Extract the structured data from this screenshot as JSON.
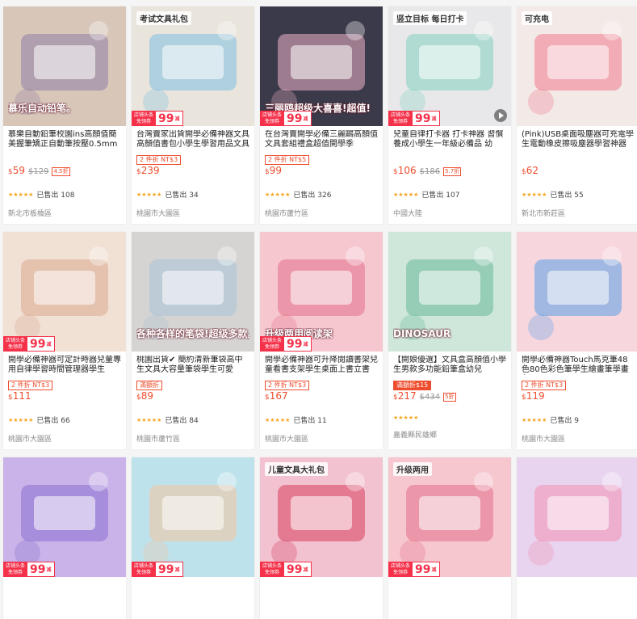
{
  "coupon": {
    "tag_line1": "店铺头条",
    "tag_line2": "免领券",
    "amount": "99",
    "unit": "减"
  },
  "products": [
    {
      "title": "慕樂自動鉛筆校園ins高顏值簡美握筆矯正自動筆按壓0.5mm",
      "thumb_headline": "慕乐自动铅笔。",
      "thumb_subhead": "",
      "promo": "",
      "promo_style": "",
      "price": "59",
      "orig": "$129",
      "disc": "4.5折",
      "stars": "★★★★★",
      "sold": "已售出 108",
      "location": "新北市板橋區",
      "bg": "#d8c6b9",
      "accent": "#8f7fa6",
      "has_coupon": false,
      "has_play": false
    },
    {
      "title": "台灣賣家出貨開學必備神器文具高顏值書包小學生學習用品文具",
      "thumb_headline": "",
      "thumb_subhead": "考试文具礼包",
      "promo": "2 件折 NT$3",
      "promo_style": "outline",
      "price": "239",
      "orig": "",
      "disc": "",
      "stars": "★★★★★",
      "sold": "已售出 34",
      "location": "桃園市大園區",
      "bg": "#e9e4dc",
      "accent": "#7fbfe0",
      "has_coupon": true,
      "has_play": false
    },
    {
      "title": "在台灣賣開學必備三麗鷗高顏值文具套組禮盒超值開學季",
      "thumb_headline": "三丽鸥超级大喜喜!超值!",
      "thumb_subhead": "",
      "promo": "2 件折 NT$5",
      "promo_style": "outline",
      "price": "99",
      "orig": "",
      "disc": "",
      "stars": "★★★★★",
      "sold": "已售出 326",
      "location": "桃園市蘆竹區",
      "bg": "#3b3a4a",
      "accent": "#f0b3c8",
      "has_coupon": true,
      "has_play": false
    },
    {
      "title": "兒童自律打卡器 打卡神器 習慣養成小學生一年級必備品 幼",
      "thumb_headline": "",
      "thumb_subhead": "竖立目标 每日打卡",
      "promo": "",
      "promo_style": "",
      "price": "106",
      "orig": "$186",
      "disc": "5.7折",
      "stars": "★★★★★",
      "sold": "已售出 107",
      "location": "中國大陸",
      "bg": "#e8e8ea",
      "accent": "#7fd0c0",
      "has_coupon": true,
      "has_play": true
    },
    {
      "title": "(Pink)USB桌面吸塵器可充電學生電動橡皮擦吸塵器學習神器",
      "thumb_headline": "",
      "thumb_subhead": "可充电",
      "promo": "",
      "promo_style": "",
      "price": "62",
      "orig": "",
      "disc": "",
      "stars": "★★★★★",
      "sold": "已售出 55",
      "location": "新北市新莊區",
      "bg": "#f3e9e6",
      "accent": "#ee7a8e",
      "has_coupon": false,
      "has_play": false
    },
    {
      "title": "開學必備神器可定計時器兒童專用自律學習時間管理器學生",
      "thumb_headline": "",
      "thumb_subhead": "",
      "promo": "2 件折 NT$3",
      "promo_style": "outline",
      "price": "111",
      "orig": "",
      "disc": "",
      "stars": "★★★★★",
      "sold": "已售出 66",
      "location": "桃園市大園區",
      "bg": "#f1e0d4",
      "accent": "#d8a98e",
      "has_coupon": true,
      "has_play": false
    },
    {
      "title": "桃園出貨✔ 簡約清新筆袋高中生文具大容量筆袋學生可愛",
      "thumb_headline": "各种各样的笔袋!超级多款。",
      "thumb_subhead": "",
      "promo": "滿額折",
      "promo_style": "outline",
      "price": "89",
      "orig": "",
      "disc": "",
      "stars": "★★★★★",
      "sold": "已售出 84",
      "location": "桃園市蘆竹區",
      "bg": "#d6d4d2",
      "accent": "#a7c2d8",
      "has_coupon": false,
      "has_play": false
    },
    {
      "title": "開學必備神器可升降閱讀書架兒童看書支架學生桌面上書立書",
      "thumb_headline": "升级两用阅读架",
      "thumb_subhead": "",
      "promo": "2 件折 NT$3",
      "promo_style": "outline",
      "price": "167",
      "orig": "",
      "disc": "",
      "stars": "★★★★★",
      "sold": "已售出 11",
      "location": "桃園市大園區",
      "bg": "#f6c7cf",
      "accent": "#e46f8b",
      "has_coupon": true,
      "has_play": false
    },
    {
      "title": "【開娘優選】文具盒高顏值小學生男款多功能鉛筆盒幼兒",
      "thumb_headline": "DINOSAUR",
      "thumb_subhead": "",
      "promo": "滿額折$15",
      "promo_style": "solid",
      "price": "217",
      "orig": "$434",
      "disc": "5折",
      "stars": "★★★★★",
      "sold": "",
      "location": "嘉義縣民雄鄉",
      "bg": "#cfe7da",
      "accent": "#67b89a",
      "has_coupon": false,
      "has_play": false
    },
    {
      "title": "開學必備神器Touch馬克筆48色80色彩色筆學生繪畫筆學畫必",
      "thumb_headline": "",
      "thumb_subhead": "",
      "promo": "2 件折 NT$3",
      "promo_style": "outline",
      "price": "119",
      "orig": "",
      "disc": "",
      "stars": "★★★★★",
      "sold": "已售出 9",
      "location": "桃園市大園區",
      "bg": "#f7d6de",
      "accent": "#5aa0e6",
      "has_coupon": false,
      "has_play": false
    },
    {
      "title": "",
      "thumb_headline": "",
      "thumb_subhead": "",
      "promo": "",
      "promo_style": "",
      "price": "",
      "orig": "",
      "disc": "",
      "stars": "",
      "sold": "",
      "location": "",
      "bg": "#c9b3e8",
      "accent": "#8a6fd2",
      "has_coupon": true,
      "has_play": false
    },
    {
      "title": "",
      "thumb_headline": "",
      "thumb_subhead": "",
      "promo": "",
      "promo_style": "",
      "price": "",
      "orig": "",
      "disc": "",
      "stars": "",
      "sold": "",
      "location": "",
      "bg": "#bde2ec",
      "accent": "#f5c4a0",
      "has_coupon": true,
      "has_play": false
    },
    {
      "title": "",
      "thumb_headline": "",
      "thumb_subhead": "儿童文具大礼包",
      "promo": "",
      "promo_style": "",
      "price": "",
      "orig": "",
      "disc": "",
      "stars": "",
      "sold": "",
      "location": "",
      "bg": "#f3c2d0",
      "accent": "#d7405f",
      "has_coupon": true,
      "has_play": false
    },
    {
      "title": "",
      "thumb_headline": "",
      "thumb_subhead": "升级两用",
      "promo": "",
      "promo_style": "",
      "price": "",
      "orig": "",
      "disc": "",
      "stars": "",
      "sold": "",
      "location": "",
      "bg": "#f6c7cf",
      "accent": "#e46f8b",
      "has_coupon": true,
      "has_play": false
    },
    {
      "title": "",
      "thumb_headline": "",
      "thumb_subhead": "",
      "promo": "",
      "promo_style": "",
      "price": "",
      "orig": "",
      "disc": "",
      "stars": "",
      "sold": "",
      "location": "",
      "bg": "#e9d4f0",
      "accent": "#f08fb0",
      "has_coupon": false,
      "has_play": false
    }
  ]
}
